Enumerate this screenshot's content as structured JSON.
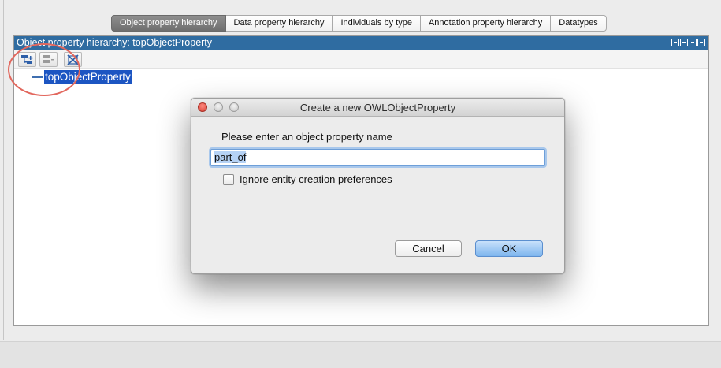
{
  "tabs": [
    {
      "label": "Object property hierarchy",
      "active": true
    },
    {
      "label": "Data property hierarchy",
      "active": false
    },
    {
      "label": "Individuals by type",
      "active": false
    },
    {
      "label": "Annotation property hierarchy",
      "active": false
    },
    {
      "label": "Datatypes",
      "active": false
    }
  ],
  "view": {
    "title": "Object property hierarchy: topObjectProperty",
    "toolbar": {
      "add_sub_icon": "add-subproperty-icon",
      "add_sibling_icon": "add-sibling-property-icon",
      "delete_icon": "delete-property-icon"
    },
    "tree_root": "topObjectProperty",
    "accent_color": "#2f6ca1",
    "selection_color": "#1c55c2"
  },
  "dialog": {
    "title": "Create a new OWLObjectProperty",
    "prompt": "Please enter an object property name",
    "name_value": "part_of",
    "checkbox_label": "Ignore entity creation preferences",
    "checkbox_checked": false,
    "cancel_label": "Cancel",
    "ok_label": "OK"
  }
}
